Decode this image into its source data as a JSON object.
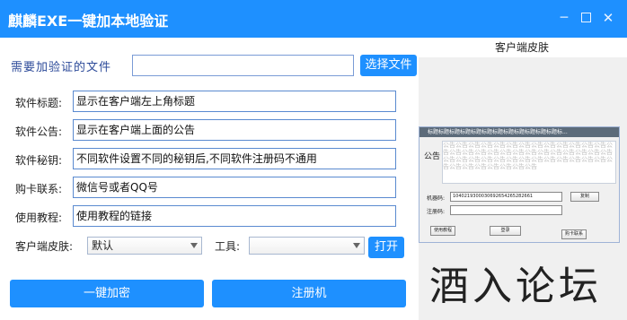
{
  "window": {
    "title": "麒麟EXE一键加本地验证",
    "minimize": "─",
    "close": "✕"
  },
  "file": {
    "label": "需要加验证的文件",
    "value": "",
    "select_button": "选择文件"
  },
  "fields": [
    {
      "label": "软件标题:",
      "value": "显示在客户端左上角标题"
    },
    {
      "label": "软件公告:",
      "value": "显示在客户端上面的公告"
    },
    {
      "label": "软件秘钥:",
      "value": "不同软件设置不同的秘钥后,不同软件注册码不通用"
    },
    {
      "label": "购卡联系:",
      "value": "微信号或者QQ号"
    },
    {
      "label": "使用教程:",
      "value": "使用教程的链接"
    }
  ],
  "options": {
    "skin_label": "客户端皮肤:",
    "skin_value": "默认",
    "tool_label": "工具:",
    "tool_value": "",
    "open_button": "打开"
  },
  "actions": {
    "encrypt": "一键加密",
    "register": "注册机"
  },
  "skin_preview": {
    "title": "客户端皮肤",
    "window_title": "标题标题标题标题标题标题标题标题标题标题标题标题标...",
    "notice_label": "公告",
    "notice_text": "公告公告公告公告公告公告公告公告公告公告公告公告公告公告公告公告公告公告公告公告公告公告公告公告公告公告公告公告公告公告公告公告公告公告公告公告公告公告公告公告公告公告公告公告公告公告公告公告",
    "machine_label": "机器码:",
    "machine_value": "1040219300030692654265282661",
    "copy_button": "复制",
    "regcode_label": "注册码:",
    "tutorial_button": "使用教程",
    "login_button": "登录",
    "buy_button": "购卡联系"
  },
  "watermark": "酒入论坛"
}
